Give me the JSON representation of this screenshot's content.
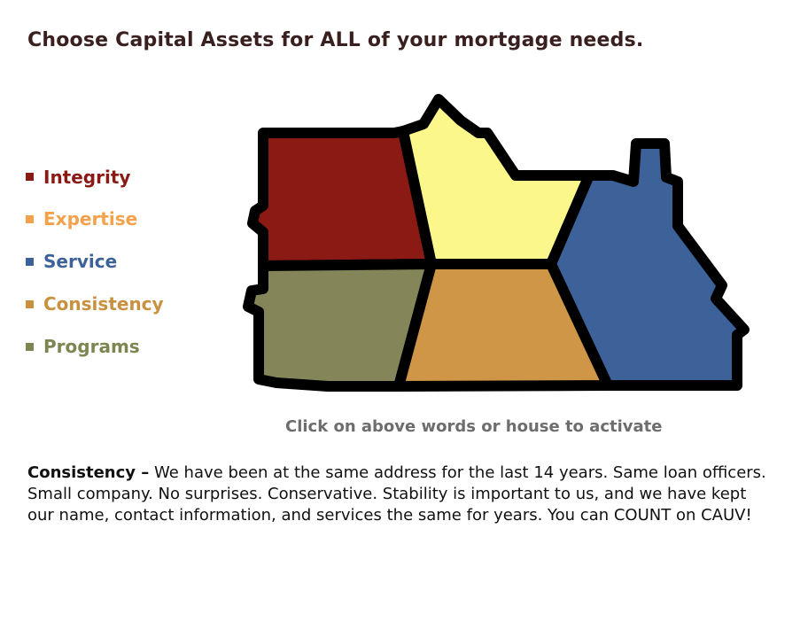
{
  "headline": "Choose Capital Assets for ALL of your mortgage needs.",
  "nav": [
    {
      "label": "Integrity",
      "color": "#8c1a14"
    },
    {
      "label": "Expertise",
      "color": "#f4a14c"
    },
    {
      "label": "Service",
      "color": "#3d6299"
    },
    {
      "label": "Consistency",
      "color": "#c8903f"
    },
    {
      "label": "Programs",
      "color": "#7d8551"
    }
  ],
  "house_colors": {
    "integrity": "#8c1a14",
    "expertise": "#fcf78a",
    "service": "#3d6299",
    "consistency": "#cf9647",
    "programs": "#848659",
    "outline": "#000000"
  },
  "instruction": "Click on above words or house to activate",
  "description": {
    "term": "Consistency –",
    "text": " We have been at the same address for the last 14 years.  Same loan officers.  Small company.  No surprises.  Conservative.  Stability is important to us, and we have kept our name, contact information, and services the same for years.  You can COUNT on CAUV!"
  }
}
